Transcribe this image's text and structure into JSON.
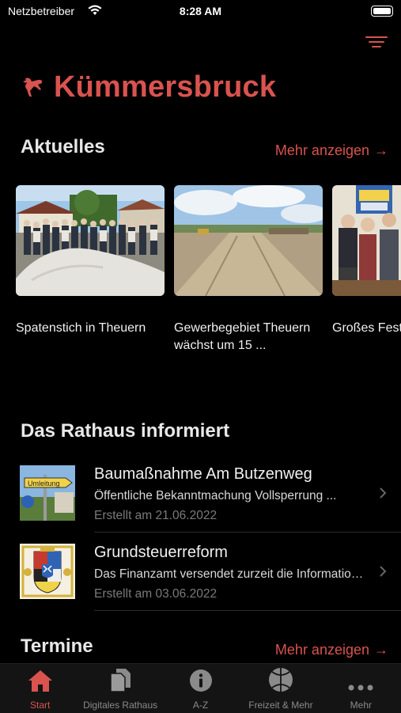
{
  "status_bar": {
    "carrier": "Netzbetreiber",
    "time": "8:28 AM"
  },
  "header": {
    "app_title": "Kümmersbruck"
  },
  "colors": {
    "accent": "#d9534f",
    "background": "#000000"
  },
  "news": {
    "title": "Aktuelles",
    "more_label": "Mehr anzeigen",
    "arrow": "→",
    "items": [
      {
        "caption": "Spatenstich in Theuern"
      },
      {
        "caption": "Gewerbegebiet Theuern wächst um 15 ..."
      },
      {
        "caption": "Großes Fest Städtepartn"
      }
    ]
  },
  "town_hall": {
    "title": "Das Rathaus informiert",
    "items": [
      {
        "title": "Baumaßnahme Am Butzenweg",
        "subtitle": "Öffentliche Bekanntmachung  Vollsperrung ...",
        "date": "Erstellt am 21.06.2022",
        "sign_text": "Umleitung"
      },
      {
        "title": "Grundsteuerreform",
        "subtitle": "Das Finanzamt versendet zurzeit die Informationen ...",
        "date": "Erstellt am 03.06.2022"
      }
    ]
  },
  "events": {
    "title": "Termine",
    "more_label": "Mehr anzeigen",
    "arrow": "→"
  },
  "tabbar": {
    "tabs": [
      {
        "label": "Start",
        "icon": "home-icon",
        "active": true
      },
      {
        "label": "Digitales Rathaus",
        "icon": "documents-icon"
      },
      {
        "label": "A-Z",
        "icon": "info-icon"
      },
      {
        "label": "Freizeit & Mehr",
        "icon": "ball-icon"
      },
      {
        "label": "Mehr",
        "icon": "more-dots-icon"
      }
    ]
  }
}
